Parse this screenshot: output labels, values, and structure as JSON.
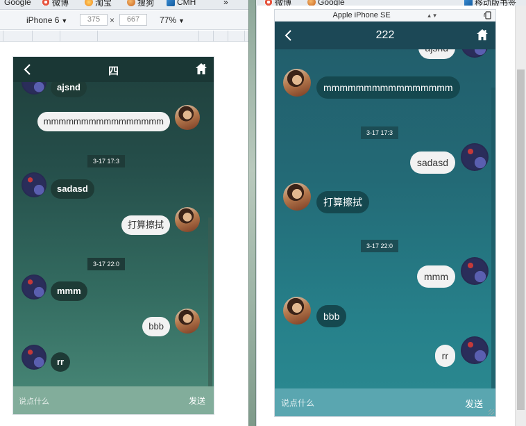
{
  "left_browser": {
    "bookmarks": [
      {
        "label": "Google",
        "icon": "google-icon"
      },
      {
        "label": "微博",
        "icon": "weibo-icon"
      },
      {
        "label": "淘宝",
        "icon": "taobao-icon"
      },
      {
        "label": "搜狗",
        "icon": "sogou-icon"
      },
      {
        "label": "CMH",
        "icon": "cmh-icon"
      }
    ],
    "overflow_label": "»",
    "toolbar": {
      "device": "iPhone 6",
      "width": "375",
      "times": "×",
      "height": "667",
      "zoom": "77%"
    },
    "phone": {
      "title": "四",
      "messages": [
        {
          "type": "recv",
          "text": "ajsnd",
          "avatar": "blue"
        },
        {
          "type": "sent",
          "text": "mmmmmmmmmmmmmmmm",
          "avatar": "man"
        },
        {
          "type": "time",
          "text": "3-17 17:3"
        },
        {
          "type": "recv",
          "text": "sadasd",
          "avatar": "blue"
        },
        {
          "type": "sent",
          "text": "打算擦拭",
          "avatar": "man"
        },
        {
          "type": "time",
          "text": "3-17 22:0"
        },
        {
          "type": "recv",
          "text": "mmm",
          "avatar": "blue"
        },
        {
          "type": "sent",
          "text": "bbb",
          "avatar": "man"
        },
        {
          "type": "recv",
          "text": "rr",
          "avatar": "blue"
        }
      ],
      "input_placeholder": "说点什么",
      "send_label": "发送"
    }
  },
  "right_browser": {
    "bookmarks": [
      {
        "label": "微博",
        "icon": "weibo-icon"
      },
      {
        "label": "Google",
        "icon": "google-icon"
      },
      {
        "label": "移动版书签",
        "icon": "mobile-bookmarks-icon"
      }
    ],
    "device": "Apple iPhone SE",
    "phone": {
      "title": "222",
      "messages": [
        {
          "type": "sent",
          "text": "ajsnd",
          "avatar": "blue"
        },
        {
          "type": "recv",
          "text": "mmmmmmmmmmmmmmmm",
          "avatar": "man"
        },
        {
          "type": "time",
          "text": "3-17 17:3"
        },
        {
          "type": "sent",
          "text": "sadasd",
          "avatar": "blue"
        },
        {
          "type": "recv",
          "text": "打算擦拭",
          "avatar": "man"
        },
        {
          "type": "time",
          "text": "3-17 22:0"
        },
        {
          "type": "sent",
          "text": "mmm",
          "avatar": "blue"
        },
        {
          "type": "recv",
          "text": "bbb",
          "avatar": "man"
        },
        {
          "type": "sent",
          "text": "rr",
          "avatar": "blue"
        }
      ],
      "input_placeholder": "说点什么",
      "send_label": "发送"
    }
  },
  "colors": {
    "left_header": "#1a3735",
    "left_input_bar": "#82ad9b",
    "right_header": "#1c4856",
    "right_input_bar": "#5aa6b0",
    "sent_bubble": "#f2f2f2"
  }
}
